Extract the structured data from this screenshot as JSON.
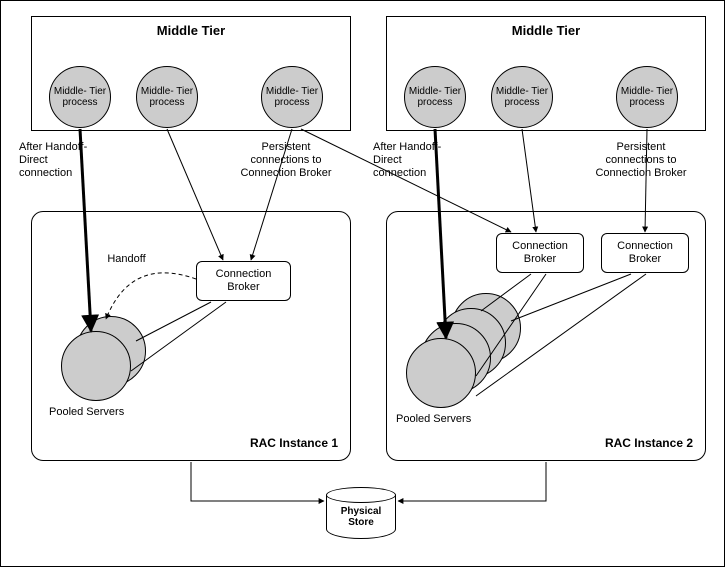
{
  "middle_tier": {
    "title": "Middle Tier",
    "process_label": "Middle-\nTier\nprocess"
  },
  "labels": {
    "after_handoff": "After Handoff-\nDirect\nconnection",
    "persistent": "Persistent\nconnections to\nConnection Broker",
    "handoff": "Handoff",
    "pooled_servers": "Pooled Servers",
    "connection_broker": "Connection\nBroker"
  },
  "rac": {
    "instance1": "RAC Instance 1",
    "instance2": "RAC Instance 2"
  },
  "store": {
    "label": "Physical\nStore"
  }
}
